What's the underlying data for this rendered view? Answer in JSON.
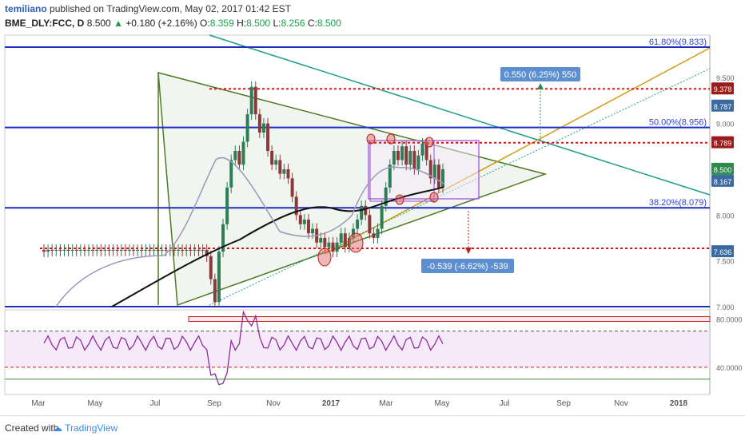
{
  "header": {
    "username": "temiliano",
    "published_text": "published on TradingView.com, May 02, 2017 01:42 EST",
    "symbol": "BME_DLY:FCC, D",
    "last": "8.500",
    "change": "+0.180 (+2.16%)",
    "ohlc_open_label": "O:",
    "ohlc_open": "8.359",
    "ohlc_high_label": "H:",
    "ohlc_high": "8.500",
    "ohlc_low_label": "L:",
    "ohlc_low": "8.256",
    "ohlc_close_label": "C:",
    "ohlc_close": "8.500"
  },
  "footer": {
    "created_with": "Created with",
    "brand": "TradingView"
  },
  "colors": {
    "up": "#2f7d57",
    "down": "#8b3a3a",
    "ema_black": "#111111",
    "ema_grey": "#9c97b8",
    "blue": "#1f2fc4",
    "red_dotted": "#c21d1d",
    "green_triangle": "#4e7a24",
    "teal": "#1d9c8a",
    "orange": "#d39a10",
    "purple": "#9b4bd6",
    "rsi": "#8e2b9e"
  },
  "chart_data": {
    "type": "candlestick",
    "x_axis_ticks": [
      "Mar",
      "May",
      "Jul",
      "Sep",
      "Nov",
      "2017",
      "Mar",
      "May",
      "Jul",
      "Sep",
      "Nov",
      "2018"
    ],
    "y_axis_ticks": [
      "9.500",
      "9.000",
      "8.000",
      "7.500",
      "7.000"
    ],
    "price_badges": [
      {
        "label": "9.378",
        "value": 9.378,
        "color": "#9c1c1c"
      },
      {
        "label": "8.787",
        "value": 9.19,
        "color": "#3a6aa0"
      },
      {
        "label": "8.789",
        "value": 8.79,
        "color": "#9c1c1c"
      },
      {
        "label": "8.500",
        "value": 8.5,
        "color": "#2f8a4e"
      },
      {
        "label": "8.167",
        "value": 8.37,
        "color": "#3a6aa0"
      },
      {
        "label": "7.636",
        "value": 7.6,
        "color": "#3a6aa0"
      }
    ],
    "fib_levels": [
      {
        "label": "61.80%(9.833)",
        "value": 9.833
      },
      {
        "label": "50.00%(8.956)",
        "value": 8.956
      },
      {
        "label": "38.20%(8.079)",
        "value": 8.079
      }
    ],
    "red_levels": [
      9.378,
      8.789,
      7.636
    ],
    "blue_extra_lines": [
      7.0
    ],
    "measure_up": {
      "label": "0.550 (6.25%) 550"
    },
    "measure_down": {
      "label": "-0.539 (-6.62%) -539"
    },
    "rsi": {
      "y_ticks": [
        "80.0000",
        "40.0000"
      ],
      "overbought": 70,
      "oversold": 40,
      "band_top": 80,
      "band_bottom": 30
    },
    "candles_approx": [
      [
        7.62,
        7.6
      ],
      [
        7.6,
        7.62
      ],
      [
        7.62,
        7.61
      ],
      [
        7.61,
        7.62
      ],
      [
        7.62,
        7.61
      ],
      [
        7.61,
        7.62
      ],
      [
        7.62,
        7.61
      ],
      [
        7.61,
        7.62
      ],
      [
        7.62,
        7.61
      ],
      [
        7.61,
        7.62
      ],
      [
        7.62,
        7.61
      ],
      [
        7.61,
        7.62
      ],
      [
        7.62,
        7.61
      ],
      [
        7.61,
        7.62
      ],
      [
        7.62,
        7.61
      ],
      [
        7.61,
        7.62
      ],
      [
        7.62,
        7.61
      ],
      [
        7.61,
        7.62
      ],
      [
        7.62,
        7.61
      ],
      [
        7.61,
        7.62
      ],
      [
        7.62,
        7.61
      ],
      [
        7.61,
        7.62
      ],
      [
        7.62,
        7.61
      ],
      [
        7.61,
        7.62
      ],
      [
        7.62,
        7.61
      ],
      [
        7.61,
        7.62
      ],
      [
        7.62,
        7.61
      ],
      [
        7.61,
        7.62
      ],
      [
        7.62,
        7.61
      ],
      [
        7.61,
        7.62
      ],
      [
        7.62,
        7.61
      ],
      [
        7.61,
        7.62
      ],
      [
        7.62,
        7.61
      ],
      [
        7.61,
        7.62
      ],
      [
        7.62,
        7.61
      ],
      [
        7.61,
        7.62
      ],
      [
        7.62,
        7.61
      ],
      [
        7.61,
        7.62
      ],
      [
        7.62,
        7.61
      ],
      [
        7.61,
        7.62
      ],
      [
        7.62,
        7.55
      ],
      [
        7.55,
        7.3
      ],
      [
        7.3,
        7.05
      ],
      [
        7.05,
        7.6
      ],
      [
        7.6,
        7.9
      ],
      [
        7.9,
        8.3
      ],
      [
        8.3,
        8.6
      ],
      [
        8.6,
        8.7
      ],
      [
        8.7,
        8.55
      ],
      [
        8.55,
        8.8
      ],
      [
        8.8,
        9.1
      ],
      [
        9.1,
        9.4
      ],
      [
        9.4,
        9.1
      ],
      [
        9.1,
        8.9
      ],
      [
        8.9,
        9.0
      ],
      [
        9.0,
        8.7
      ],
      [
        8.7,
        8.55
      ],
      [
        8.55,
        8.6
      ],
      [
        8.6,
        8.45
      ],
      [
        8.45,
        8.5
      ],
      [
        8.5,
        8.4
      ],
      [
        8.4,
        8.2
      ],
      [
        8.2,
        8.0
      ],
      [
        8.0,
        7.9
      ],
      [
        7.9,
        7.95
      ],
      [
        7.95,
        7.8
      ],
      [
        7.8,
        7.85
      ],
      [
        7.85,
        7.7
      ],
      [
        7.7,
        7.75
      ],
      [
        7.75,
        7.65
      ],
      [
        7.65,
        7.7
      ],
      [
        7.7,
        7.6
      ],
      [
        7.6,
        7.7
      ],
      [
        7.7,
        7.8
      ],
      [
        7.8,
        7.65
      ],
      [
        7.65,
        7.75
      ],
      [
        7.75,
        7.85
      ],
      [
        7.85,
        7.95
      ],
      [
        7.95,
        8.1
      ],
      [
        8.1,
        8.0
      ],
      [
        8.0,
        7.8
      ],
      [
        7.8,
        7.75
      ],
      [
        7.75,
        7.85
      ],
      [
        7.85,
        8.1
      ],
      [
        8.1,
        8.3
      ],
      [
        8.3,
        8.55
      ],
      [
        8.55,
        8.7
      ],
      [
        8.7,
        8.6
      ],
      [
        8.6,
        8.75
      ],
      [
        8.75,
        8.55
      ],
      [
        8.55,
        8.7
      ],
      [
        8.7,
        8.5
      ],
      [
        8.5,
        8.65
      ],
      [
        8.65,
        8.78
      ],
      [
        8.78,
        8.6
      ],
      [
        8.6,
        8.4
      ],
      [
        8.4,
        8.55
      ],
      [
        8.55,
        8.3
      ],
      [
        8.3,
        8.5
      ]
    ]
  }
}
